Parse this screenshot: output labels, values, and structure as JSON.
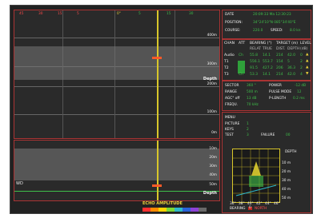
{
  "top_markers": [
    "45",
    "30",
    "15",
    "5",
    "0°",
    "5",
    "15",
    "30",
    "45"
  ],
  "range_labels": [
    "400m",
    "300m",
    "200m",
    "100m",
    "0m"
  ],
  "lower_labels": [
    "10m",
    "20m",
    "30m",
    "40m",
    "50m"
  ],
  "labels": {
    "depth_top": "Depth",
    "depth_bottom": "Depth",
    "wd": "WD"
  },
  "echo_amplitude": "ECHO AMPLITUDE",
  "amplitude_colors": [
    "#ff3030",
    "#ff8a00",
    "#ffd200",
    "#7ad636",
    "#2fb8c9",
    "#2a62d9",
    "#8d42d6",
    "#6a6a6a"
  ],
  "status": {
    "date_label": "DATE",
    "date_value": "20:09:33 Ma 12:30:23",
    "position_label": "POSITION:",
    "position_value": "34°24'10\"N 085°34'40\"E",
    "course_label": "COURSE:",
    "course_value": "220.0",
    "speed_label": "SPEED:",
    "speed_value": "8.0 kn"
  },
  "channels": {
    "headers": [
      "CHAN",
      "ATT",
      "BEARING (°)",
      "TARGET (m)",
      "LEVEL"
    ],
    "subheaders": [
      "RELAT",
      "TRUE",
      "DIST.",
      "DEPTH",
      "(dB)"
    ],
    "rows": [
      {
        "name": "Audio",
        "att": "Ch",
        "relat": "55.8",
        "true": "14.1",
        "dist": "214",
        "depth": "42.0",
        "level": "0"
      },
      {
        "name": "T1",
        "att": "",
        "relat": "556.1",
        "true": "553.7",
        "dist": "154",
        "depth": "5",
        "level": "2"
      },
      {
        "name": "T2",
        "att": "",
        "relat": "91.5",
        "true": "427.2",
        "dist": "206",
        "depth": "36.3",
        "level": "2"
      },
      {
        "name": "T3",
        "att": "Ch",
        "relat": "53.3",
        "true": "14.1",
        "dist": "214",
        "depth": "42.0",
        "level": "4"
      }
    ]
  },
  "params": {
    "sector_label": "SECTOR",
    "sector_value": "360 °",
    "power_label": "POWER",
    "power_value": "-12 dB",
    "range_label": "RANGE",
    "range_value": "500 m",
    "pulse_label": "PULSE MODE",
    "pulse_value": "12",
    "agc_label": "AGC° off",
    "agc_value": "13 dB",
    "plength_label": "P-LENGTH",
    "plength_value": "0.2 ms",
    "frequ_label": "FREQU.",
    "frequ_value": "70 kHz"
  },
  "menu": {
    "title": "MENU",
    "items": [
      {
        "label": "PICTURE",
        "value": "1"
      },
      {
        "label": "KEYS",
        "value": "2"
      },
      {
        "label": "TEST",
        "value": "3"
      }
    ],
    "failure_label": "FAILURE",
    "failure_value": "00"
  },
  "depth_chart": {
    "title": "DEPTH",
    "depth_labels": [
      "10 m",
      "20 m",
      "30 m",
      "40 m",
      "50 m"
    ],
    "bearing_ticks": [
      "36°",
      "38°",
      "40°",
      "42°",
      "44°",
      "46°"
    ],
    "bearing_label": "BEARING",
    "bearing_value": "0",
    "north_label": "NORTH"
  }
}
